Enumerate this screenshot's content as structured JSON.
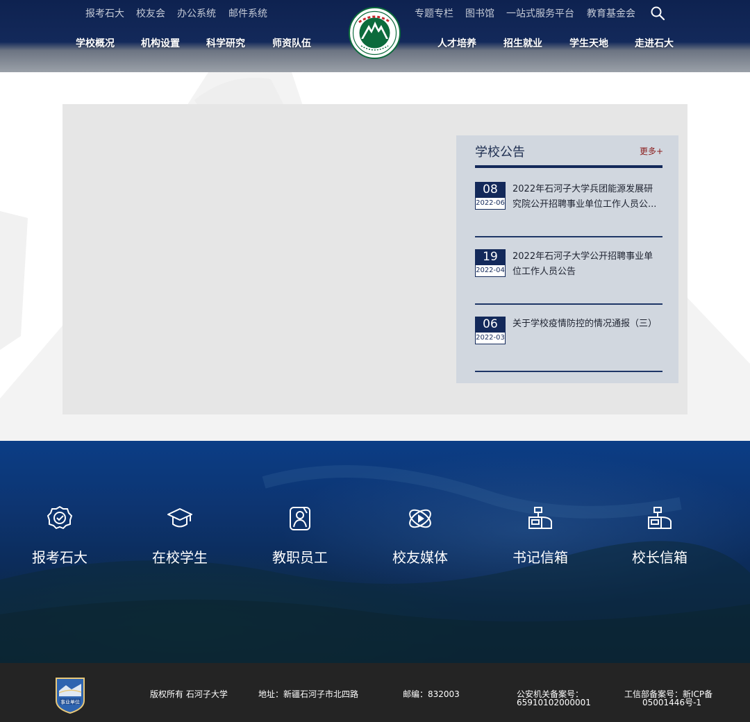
{
  "header": {
    "top_links_left": [
      "报考石大",
      "校友会",
      "办公系统",
      "邮件系统"
    ],
    "top_links_right": [
      "专题专栏",
      "图书馆",
      "一站式服务平台",
      "教育基金会"
    ],
    "nav_left": [
      "学校概况",
      "机构设置",
      "科学研究",
      "师资队伍"
    ],
    "nav_right": [
      "人才培养",
      "招生就业",
      "学生天地",
      "走进石大"
    ],
    "search_icon": "search-icon",
    "logo_icon": "university-seal-icon"
  },
  "notice": {
    "title": "学校公告",
    "more": "更多+",
    "items": [
      {
        "day": "08",
        "month": "2022-06",
        "text": "2022年石河子大学兵团能源发展研究院公开招聘事业单位工作人员公..."
      },
      {
        "day": "19",
        "month": "2022-04",
        "text": "2022年石河子大学公开招聘事业单位工作人员公告"
      },
      {
        "day": "06",
        "month": "2022-03",
        "text": "关于学校疫情防控的情况通报（三）"
      }
    ]
  },
  "quick_links": [
    {
      "label": "报考石大",
      "icon": "award-medal-icon"
    },
    {
      "label": "在校学生",
      "icon": "graduation-cap-icon"
    },
    {
      "label": "教职员工",
      "icon": "staff-profile-icon"
    },
    {
      "label": "校友媒体",
      "icon": "media-play-orbit-icon"
    },
    {
      "label": "书记信箱",
      "icon": "mailbox-icon"
    },
    {
      "label": "校长信箱",
      "icon": "mailbox-icon"
    }
  ],
  "footer": {
    "copyright": "版权所有 石河子大学",
    "address": "地址：新疆石河子市北四路",
    "postcode": "邮编：832003",
    "police_label": "公安机关备案号：",
    "police_number": "65910102000001",
    "icp_label": "工信部备案号：新ICP备",
    "icp_number": "05001446号-1",
    "badge_text": "事业单位"
  },
  "colors": {
    "navy": "#13295a",
    "accent_red": "#8a1c1c",
    "footer_bg": "#242424",
    "seal_green": "#0c6b3c"
  }
}
